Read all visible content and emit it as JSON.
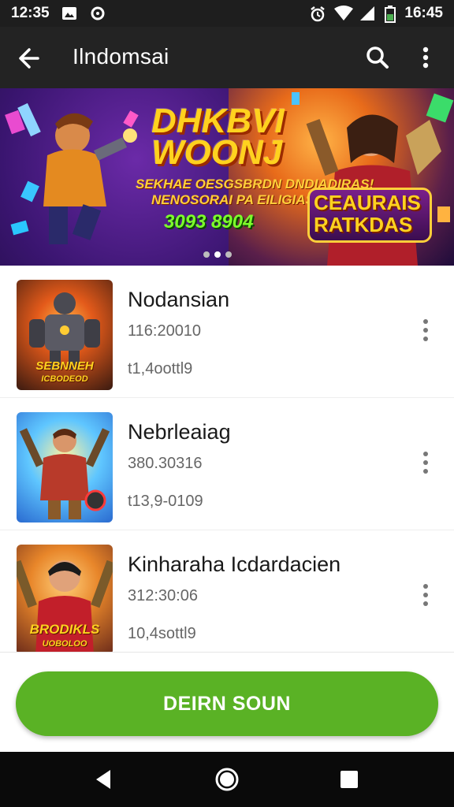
{
  "status_bar": {
    "time_left": "12:35",
    "time_right": "16:45",
    "icons": [
      "image-notification-icon",
      "circle-notification-icon",
      "alarm-icon",
      "wifi-icon",
      "signal-icon",
      "battery-icon"
    ]
  },
  "app_bar": {
    "title": "Ilndomsai",
    "icons": [
      "back-arrow-icon",
      "search-icon",
      "more-vert-icon"
    ]
  },
  "banner": {
    "heading_line1": "DHKBVI",
    "heading_line2": "WOONJ",
    "subtitle_line1": "SEKHAE OESGSBRDN DNDIADIRAS!",
    "subtitle_line2": "NENOSORAI PA EILIGIAS",
    "price": "3093 8904",
    "badge_line1": "CEAURAIS",
    "badge_line2": "RATKDAS",
    "slide_count": 3,
    "active_slide": 2
  },
  "items": [
    {
      "title": "Nodansian",
      "line1": "116:20010",
      "line2": "t1,4oottl9",
      "thumb_text": "SEBNNEH",
      "thumb_subtext": "ICBODEOD"
    },
    {
      "title": "Nebrleaiag",
      "line1": "380.30316",
      "line2": "t13,9-0109",
      "thumb_text": "",
      "thumb_subtext": ""
    },
    {
      "title": "Kinharaha Icdardacien",
      "line1": "312:30:06",
      "line2": "10,4sottl9",
      "thumb_text": "BRODIKLS",
      "thumb_subtext": "UOBOLOO"
    }
  ],
  "cta": {
    "label": "DEIRN SOUN",
    "color": "#5ab225"
  },
  "nav_bar": {
    "icons": [
      "nav-back-icon",
      "nav-home-icon",
      "nav-recents-icon"
    ]
  },
  "colors": {
    "status_bar": "#1e1e1e",
    "app_bar": "#232323",
    "accent_green": "#5ab225",
    "banner_yellow": "#ffd21f"
  }
}
